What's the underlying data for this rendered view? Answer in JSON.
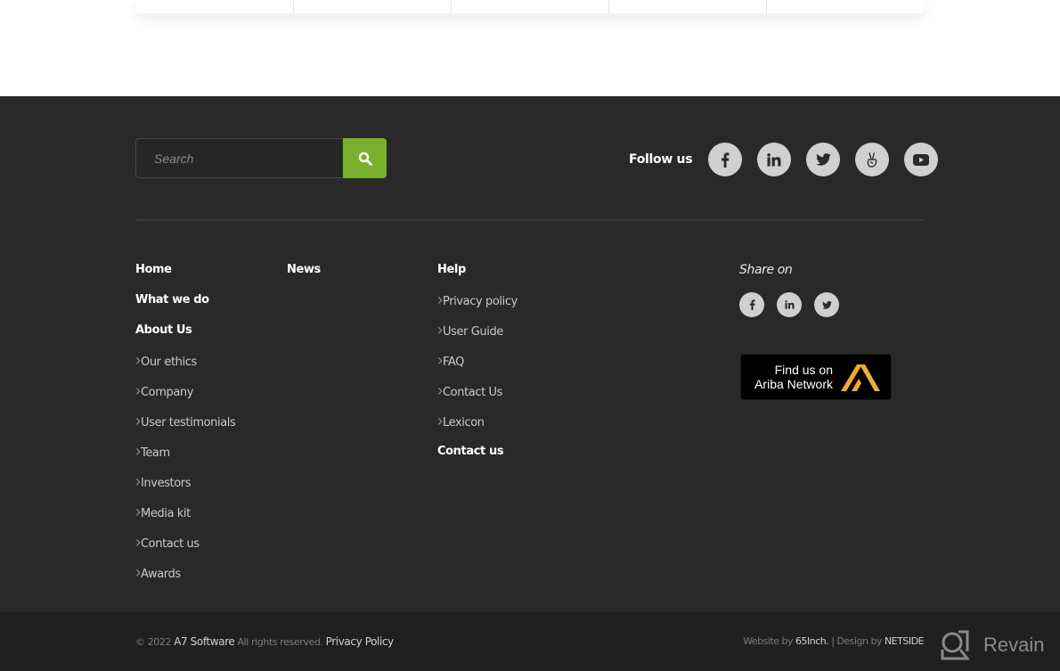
{
  "top_table": {
    "cells": 5
  },
  "search": {
    "placeholder": "Search",
    "value": ""
  },
  "follow": {
    "label": "Follow us",
    "icons": [
      "facebook-icon",
      "linkedin-icon",
      "twitter-icon",
      "angellist-icon",
      "youtube-icon"
    ]
  },
  "columns": [
    {
      "items": [
        {
          "type": "head",
          "label": "Home"
        },
        {
          "type": "head",
          "label": "What we do"
        },
        {
          "type": "head",
          "label": "About Us"
        },
        {
          "type": "sub",
          "label": "Our ethics"
        },
        {
          "type": "sub",
          "label": "Company"
        },
        {
          "type": "sub",
          "label": "User testimonials"
        },
        {
          "type": "sub",
          "label": "Team"
        },
        {
          "type": "sub",
          "label": "Investors"
        },
        {
          "type": "sub",
          "label": "Media kit"
        },
        {
          "type": "sub",
          "label": "Contact us"
        },
        {
          "type": "sub",
          "label": "Awards"
        }
      ]
    },
    {
      "items": [
        {
          "type": "head",
          "label": "News"
        }
      ]
    },
    {
      "items": [
        {
          "type": "head",
          "label": "Help"
        },
        {
          "type": "sub",
          "label": "Privacy policy"
        },
        {
          "type": "sub",
          "label": "User Guide"
        },
        {
          "type": "sub",
          "label": "FAQ"
        },
        {
          "type": "sub",
          "label": "Contact Us"
        },
        {
          "type": "sub",
          "label": "Lexicon"
        },
        {
          "type": "head",
          "label": "Contact us"
        }
      ]
    }
  ],
  "share": {
    "label": "Share on",
    "icons": [
      "facebook-icon",
      "linkedin-icon",
      "twitter-icon"
    ]
  },
  "ariba": {
    "line1": "Find us on",
    "line2": "Ariba Network",
    "logo_color": "#f0a830"
  },
  "bottom": {
    "copyright_prefix": "© 2022",
    "company": "A7 Software",
    "rights": "All rights reserved.",
    "privacy": "Privacy Policy",
    "website_by_label": "Website by",
    "website_by": "65Inch.",
    "separator": "|",
    "design_by_label": "Design by",
    "design_by": "NETSIDE"
  },
  "watermark": {
    "label": "Revain"
  },
  "colors": {
    "accent": "#79b12f",
    "footer_bg": "#292929",
    "bottom_bg": "#202020"
  }
}
